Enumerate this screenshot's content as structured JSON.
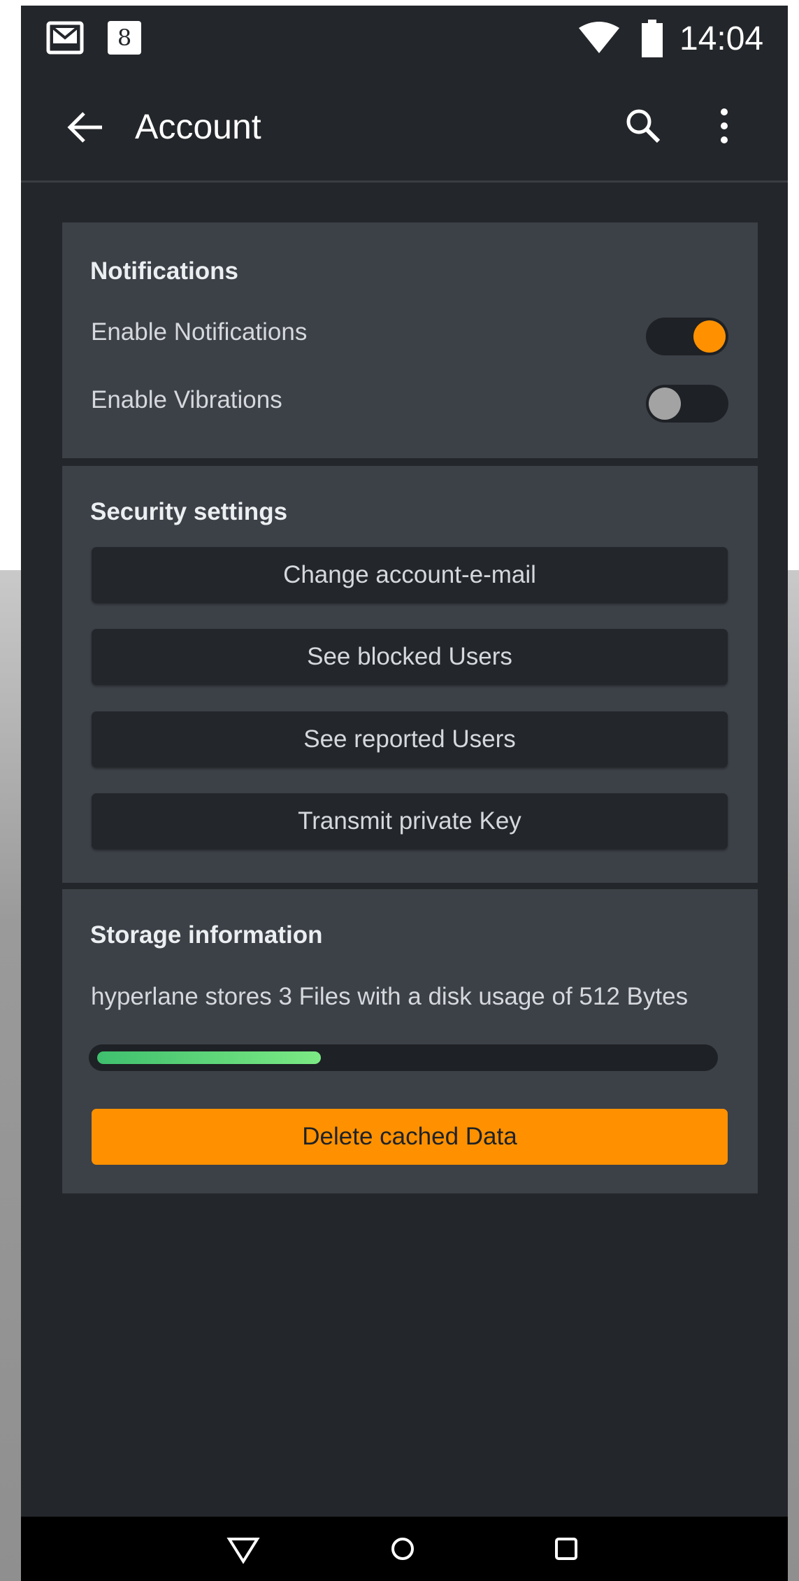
{
  "status_bar": {
    "time": "14:04",
    "icons": [
      "gmail-icon",
      "google-plus-icon",
      "wifi-icon",
      "battery-icon"
    ],
    "gplus_glyph": "8"
  },
  "app_bar": {
    "title": "Account",
    "icons": [
      "back-arrow-icon",
      "search-icon",
      "more-vert-icon"
    ]
  },
  "notifications": {
    "title": "Notifications",
    "items": [
      {
        "label": "Enable Notifications",
        "enabled": true
      },
      {
        "label": "Enable Vibrations",
        "enabled": false
      }
    ]
  },
  "security": {
    "title": "Security settings",
    "buttons": [
      {
        "label": "Change account-e-mail"
      },
      {
        "label": "See blocked Users"
      },
      {
        "label": "See reported Users"
      },
      {
        "label": "Transmit private Key"
      }
    ]
  },
  "storage": {
    "title": "Storage information",
    "description": "hyperlane stores 3 Files with a disk usage of 512 Bytes",
    "usage_fraction": 0.365,
    "delete_label": "Delete cached Data"
  },
  "nav_bar": {
    "icons": [
      "nav-back-icon",
      "nav-home-icon",
      "nav-recents-icon"
    ]
  },
  "colors": {
    "background": "#23262a",
    "card": "#3c4047",
    "accent": "#ff9100",
    "progress": "#5fd57a",
    "text": "#d5d8dc"
  }
}
